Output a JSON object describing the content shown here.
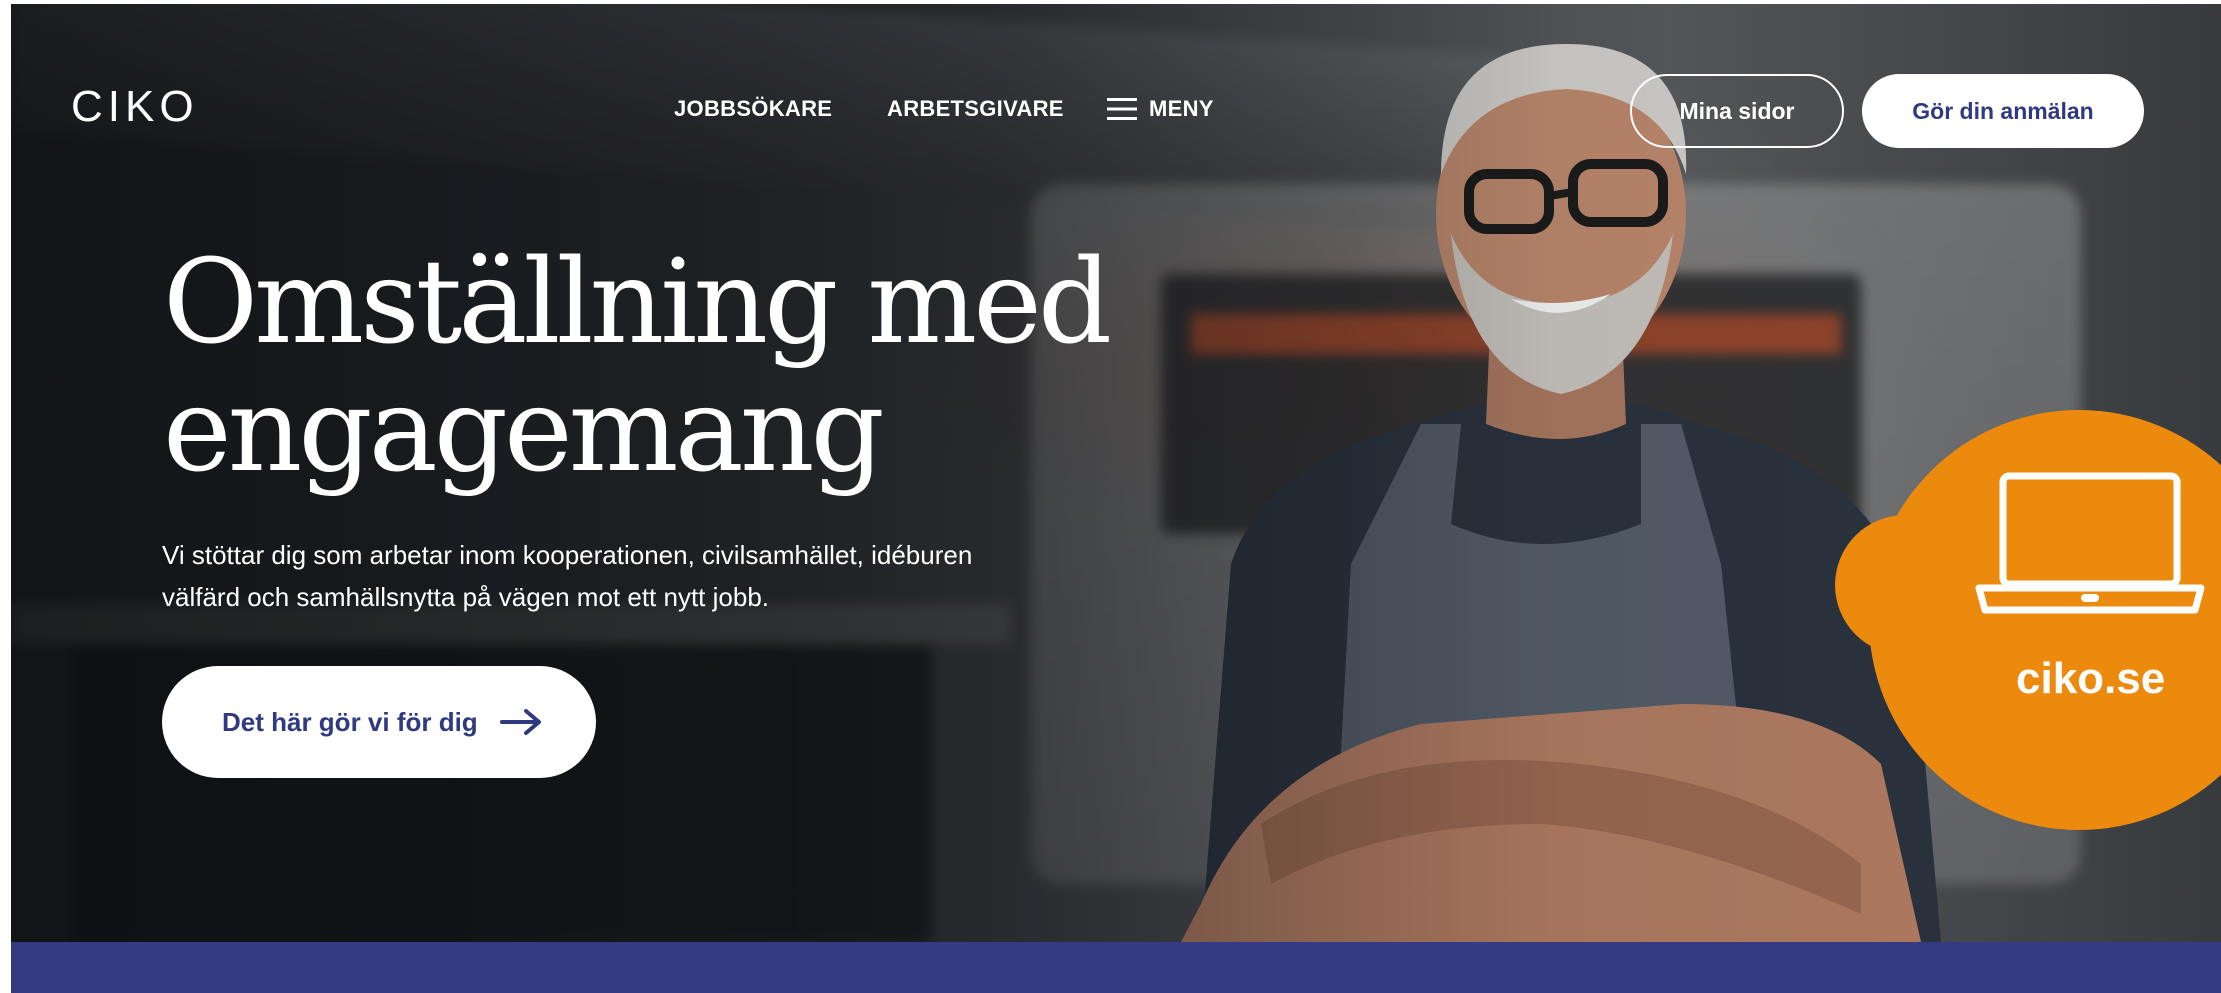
{
  "header": {
    "logo": "CIKO",
    "nav": [
      {
        "label": "JOBBSÖKARE"
      },
      {
        "label": "ARBETSGIVARE"
      },
      {
        "label": "MENY",
        "icon": "hamburger-menu-icon"
      }
    ],
    "actions": {
      "mina_sidor": "Mina sidor",
      "gor_anmalan": "Gör din anmälan"
    }
  },
  "hero": {
    "headline_line1": "Omställning med",
    "headline_line2": "engagemang",
    "subtext_line1": "Vi stöttar dig som arbetar inom kooperationen, civilsamhället, idéburen",
    "subtext_line2": "välfärd och samhällsnytta på vägen mot ett nytt jobb.",
    "cta_label": "Det här gör vi för dig",
    "cta_icon": "arrow-right-icon"
  },
  "badge": {
    "text": "ciko.se",
    "icon": "laptop-icon"
  },
  "colors": {
    "brand_navy": "#2f3a80",
    "band_blue": "#353b83",
    "badge_orange": "#ec8a0e"
  }
}
